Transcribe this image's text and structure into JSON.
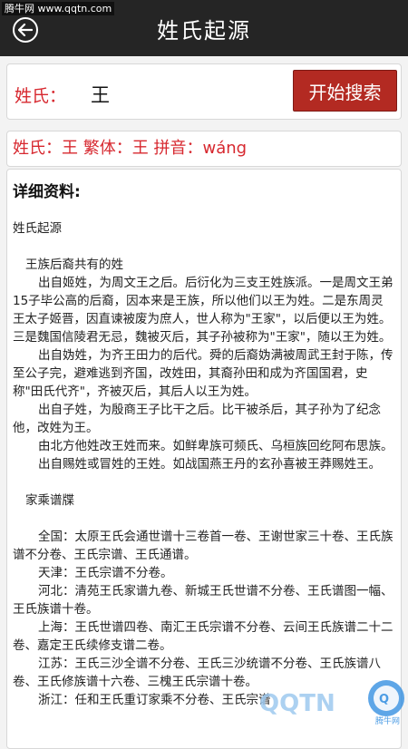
{
  "watermark": "腾牛网 www.qqtn.com",
  "header": {
    "title": "姓氏起源"
  },
  "search": {
    "label": "姓氏：",
    "value": "王",
    "button_label": "开始搜索"
  },
  "info": {
    "surname_label": "姓氏：",
    "surname": "王",
    "traditional_label": "繁体：",
    "traditional": "王",
    "pinyin_label": "拼音：",
    "pinyin": "wáng"
  },
  "detail": {
    "header": "详细资料:",
    "section1_title": "姓氏起源",
    "subtitle1": "王族后裔共有的姓",
    "para1": "出自姬姓，为周文王之后。后衍化为三支王姓族派。一是周文王弟15子毕公高的后裔，因本来是王族，所以他们以王为姓。二是东周灵王太子姬晋，因直谏被废为庶人，世人称为\"王家\"，以后便以王为姓。三是魏国信陵君无忌，魏被灭后，其子孙被称为\"王家\"，随以王为姓。",
    "para2": "出自妫姓，为齐王田力的后代。舜的后裔妫满被周武王封于陈，传至公子完，避难逃到齐国，改姓田，其裔孙田和成为齐国国君，史称\"田氏代齐\"，齐被灭后，其后人以王为姓。",
    "para3": "出自子姓，为殷商王子比干之后。比干被杀后，其子孙为了纪念他，改姓为王。",
    "para4": "由北方他姓改王姓而来。如鲜卑族可频氏、乌桓族回纥阿布思族。",
    "para5": "出自赐姓或冒姓的王姓。如战国燕王丹的玄孙喜被王莽赐姓王。",
    "section2_title": "家乘谱牒",
    "g1": "全国：太原王氏会通世谱十三卷首一卷、王谢世家三十卷、王氏族谱不分卷、王氏宗谱、王氏通谱。",
    "g2": "天津：王氏宗谱不分卷。",
    "g3": "河北：清苑王氏家谱九卷、新城王氏世谱不分卷、王氏谱图一幅、王氏族谱十卷。",
    "g4": "上海：王氏世谱四卷、南汇王氏宗谱不分卷、云间王氏族谱二十二卷、嘉定王氏续修支谱二卷。",
    "g5": "江苏：王氏三沙全谱不分卷、王氏三沙统谱不分卷、王氏族谱八卷、王氏修族谱十六卷、三槐王氏宗谱十卷。",
    "g6": "浙江：任和王氏重订家乘不分卷、王氏宗谱"
  },
  "corner_logo": {
    "text": "QQTN",
    "sub": "腾牛网"
  }
}
